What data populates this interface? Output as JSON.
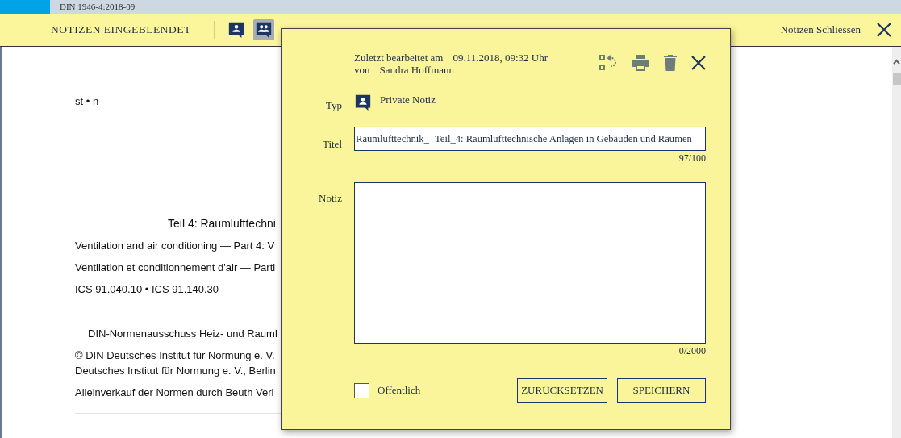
{
  "tab_bar": {
    "title": "DIN 1946-4:2018-09"
  },
  "toolbar": {
    "label": "NOTIZEN EINGEBLENDET",
    "filters": [
      {
        "kind": "private",
        "selected": false
      },
      {
        "kind": "shared",
        "selected": true
      }
    ],
    "close_label": "Notizen Schliessen"
  },
  "document": {
    "lines": [
      {
        "kind": "small",
        "text": "st • n"
      },
      {
        "kind": "title",
        "text": "Teil 4: Raumlufttechni"
      },
      {
        "kind": "line",
        "text": "Ventilation and air conditioning — Part 4: V"
      },
      {
        "kind": "line",
        "text": "Ventilation et conditionnement d'air — Parti"
      },
      {
        "kind": "line",
        "text": "ICS 91.040.10 • ICS 91.140.30"
      },
      {
        "kind": "indent",
        "text": "DIN-Normenausschuss Heiz- und Rauml"
      },
      {
        "kind": "line",
        "text": "© DIN Deutsches Institut für Normung e. V."
      },
      {
        "kind": "cont",
        "text": "Deutsches Institut für Normung e. V., Berlin"
      },
      {
        "kind": "line",
        "text": "Alleinverkauf der Normen durch Beuth Verl"
      }
    ]
  },
  "dialog": {
    "edited_label": "Zuletzt bearbeitet am",
    "edited_at": "09.11.2018, 09:32 Uhr",
    "by_label": "von",
    "author": "Sandra Hoffmann",
    "type_label": "Typ",
    "type_value": "Private Notiz",
    "title_label": "Titel",
    "title_value": "Raumlufttechnik_- Teil_4: Raumlufttechnische Anlagen in Gebäuden und Räumen",
    "title_count": "97/100",
    "note_label": "Notiz",
    "note_count": "0/2000",
    "public": {
      "label": "Öffentlich",
      "checked": false
    },
    "buttons": [
      "ZURÜCKSETZEN",
      "SPEICHERN"
    ]
  }
}
